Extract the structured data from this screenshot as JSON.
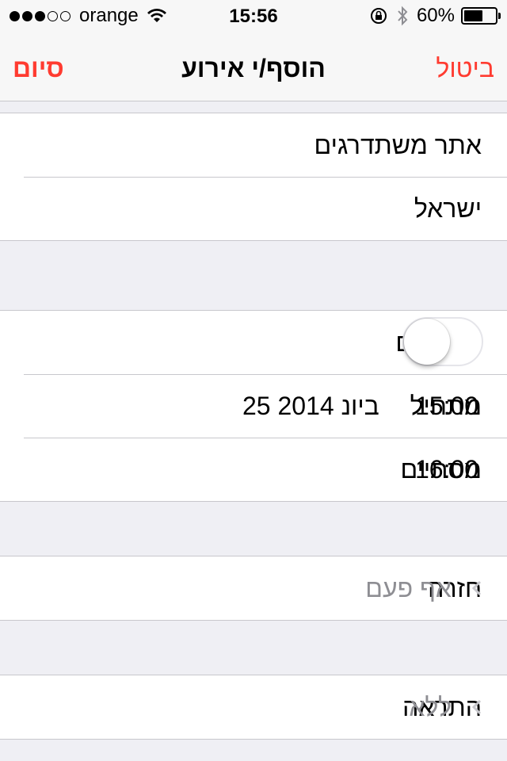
{
  "status_bar": {
    "carrier": "orange",
    "time": "15:56",
    "battery_text": "60%",
    "battery_level": 0.6,
    "signal_bars_full": 3,
    "signal_bars_total": 5
  },
  "nav": {
    "done_label": "סיום",
    "title": "הוסף/י אירוע",
    "cancel_label": "ביטול"
  },
  "details": {
    "title_value": "אתר משתדרגים",
    "location_value": "ישראל"
  },
  "timing": {
    "all_day_label": "יום שלם",
    "all_day_on": false,
    "starts_label": "מתחיל",
    "starts_date": "25 ביונ 2014",
    "starts_time": "15:00",
    "ends_label": "מסתיים",
    "ends_time": "16:00"
  },
  "repeat": {
    "label": "חזרה",
    "value": "אף פעם"
  },
  "alert": {
    "label": "התראה",
    "value": "ללא"
  },
  "colors": {
    "accent": "#ff3b30",
    "background": "#efeff4",
    "separator": "#c8c7cc",
    "secondary_text": "#8e8e93"
  }
}
